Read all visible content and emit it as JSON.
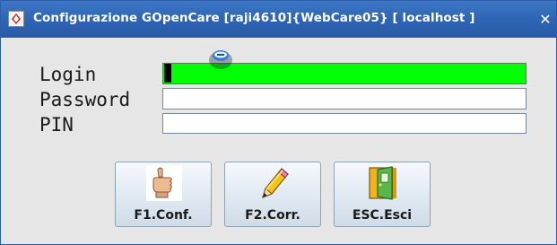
{
  "window": {
    "title": "Configurazione GOpenCare [raji4610]{WebCare05} [ localhost ]",
    "close_symbol": "✕",
    "app_icon": "app-icon"
  },
  "form": {
    "login_label": "Login",
    "password_label": "Password",
    "pin_label": "PIN",
    "login_value": "",
    "password_value": "",
    "pin_value": "",
    "login_highlight_color": "#00ff00"
  },
  "buttons": [
    {
      "label": "F1.Conf.",
      "icon": "thumbs-up-icon"
    },
    {
      "label": "F2.Corr.",
      "icon": "pencil-icon"
    },
    {
      "label": "ESC.Esci",
      "icon": "exit-door-icon"
    }
  ]
}
